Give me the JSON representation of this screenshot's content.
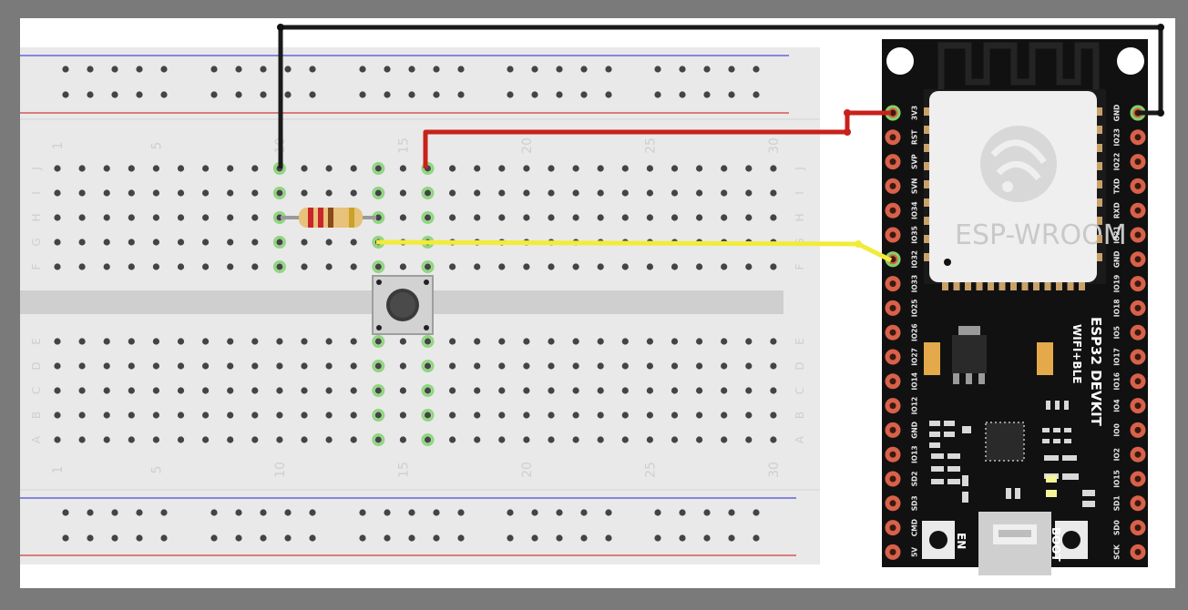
{
  "breadboard": {
    "row_labels_top": [
      "J",
      "I",
      "H",
      "G",
      "F"
    ],
    "row_labels_bottom": [
      "E",
      "D",
      "C",
      "B",
      "A"
    ],
    "column_numbers": [
      "1",
      "5",
      "10",
      "15",
      "20",
      "25",
      "30"
    ]
  },
  "esp32": {
    "module_label": "ESP-WROOM",
    "board_title": "ESP32 DEVKIT",
    "board_subtitle": "WIFI+BLE",
    "en_label": "EN",
    "boot_label": "BOOT",
    "left_pins": [
      "3V3",
      "RST",
      "SVP",
      "SVN",
      "IO34",
      "IO35",
      "IO32",
      "IO33",
      "IO25",
      "IO26",
      "IO27",
      "IO14",
      "IO12",
      "GND",
      "IO13",
      "SD2",
      "SD3",
      "CMD",
      "5V"
    ],
    "right_pins": [
      "GND",
      "IO23",
      "IO22",
      "TXD",
      "RXD",
      "IO21",
      "GND",
      "IO19",
      "IO18",
      "IO5",
      "IO17",
      "IO16",
      "IO4",
      "IO0",
      "IO2",
      "IO15",
      "SD1",
      "SD0",
      "SCK"
    ]
  },
  "wire_colors": {
    "gnd": "#1a1a1a",
    "power": "#c8211b",
    "signal": "#f1ec3a"
  },
  "colors": {
    "background": "#7a7a7a",
    "breadboard": "#e9e9e9",
    "board_pcb": "#111111",
    "pin_pad": "#d8614a",
    "highlight": "#7ed36a"
  },
  "resistor_bands": [
    "#c9252a",
    "#c9252a",
    "#8a4a1c",
    "#c9a227"
  ]
}
